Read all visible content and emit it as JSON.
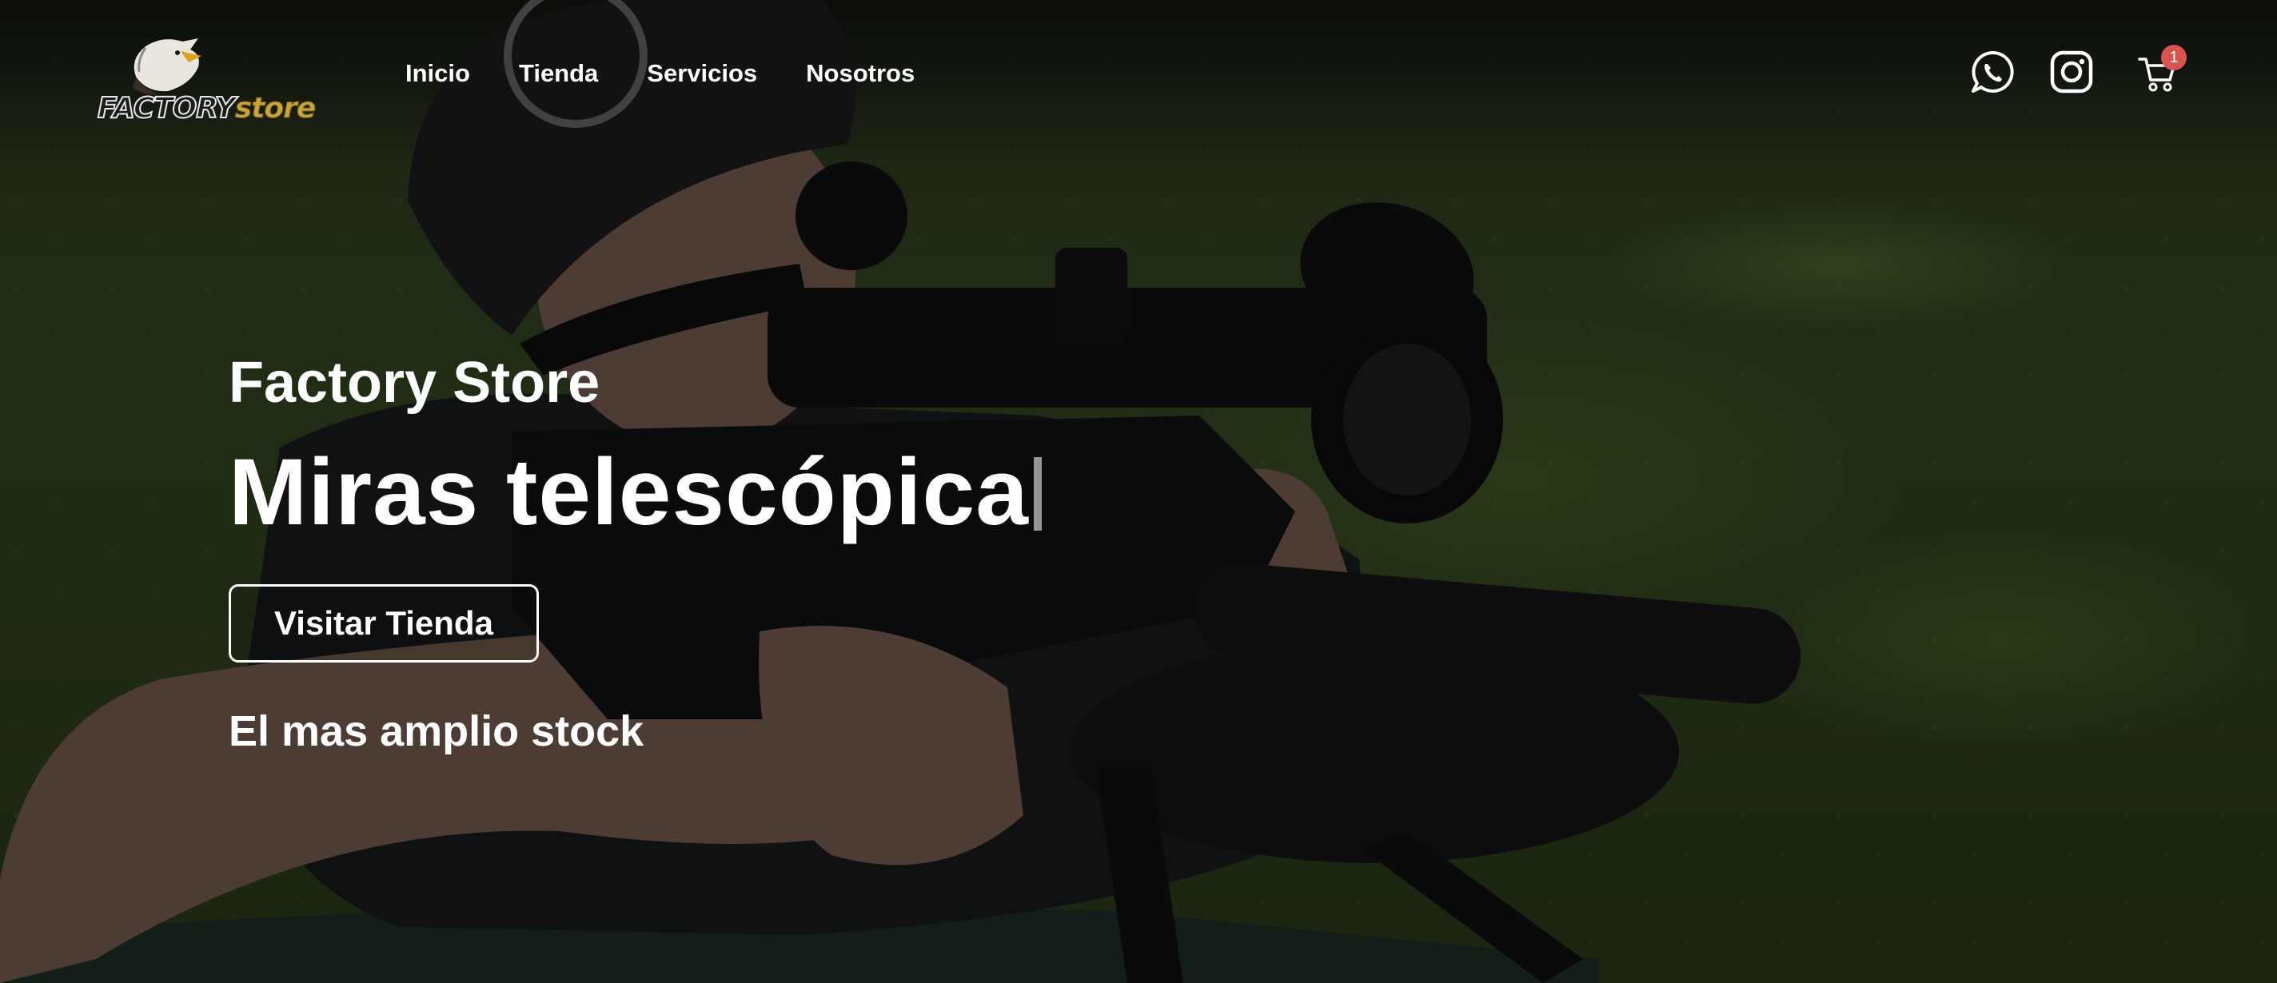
{
  "brand": {
    "logo_word_1": "FACTORY",
    "logo_word_2": "store"
  },
  "nav": {
    "items": [
      {
        "label": "Inicio"
      },
      {
        "label": "Tienda"
      },
      {
        "label": "Servicios"
      },
      {
        "label": "Nosotros"
      }
    ]
  },
  "header_icons": {
    "whatsapp": "whatsapp-icon",
    "instagram": "instagram-icon",
    "cart": "cart-icon",
    "cart_count": "1",
    "badge_color": "#d9534f"
  },
  "hero": {
    "subtitle": "Factory Store",
    "title": "Miras telescópica",
    "button_label": "Visitar Tienda",
    "tagline": "El mas amplio stock"
  },
  "colors": {
    "text": "#ffffff",
    "logo_accent": "#c9a43b"
  }
}
